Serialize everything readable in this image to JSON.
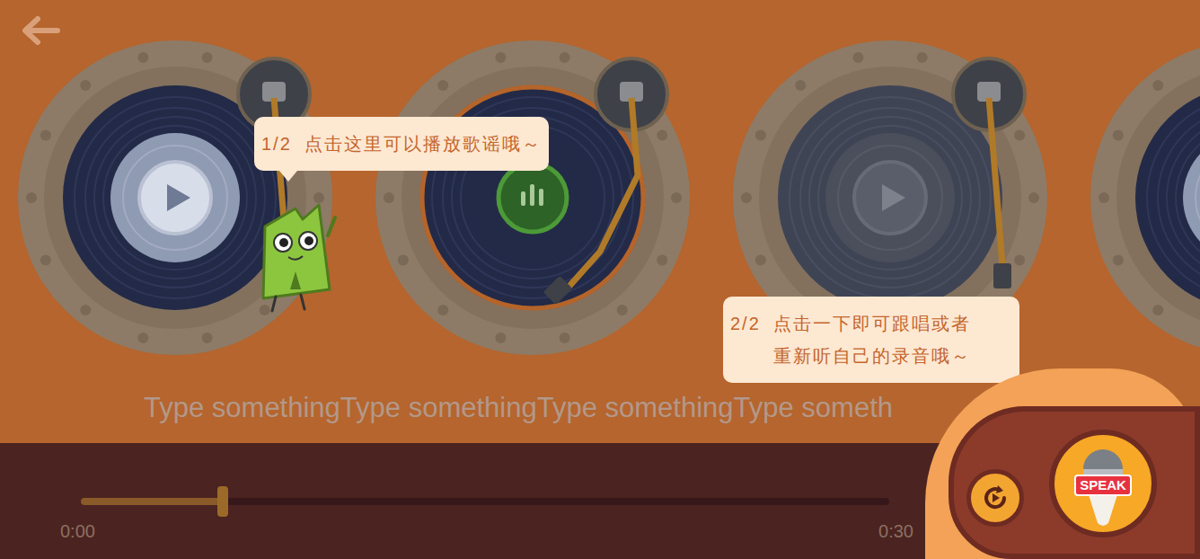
{
  "records": [
    {
      "playing": false,
      "disabled": false
    },
    {
      "playing": true,
      "disabled": false
    },
    {
      "playing": false,
      "disabled": true
    },
    {
      "playing": false,
      "disabled": false
    }
  ],
  "tooltips": [
    {
      "step": "1/2",
      "lines": [
        "点击这里可以播放歌谣哦～"
      ]
    },
    {
      "step": "2/2",
      "lines": [
        "点击一下即可跟唱或者",
        "重新听自己的录音哦～"
      ]
    }
  ],
  "lyric": "Type somethingType somethingType somethingType someth",
  "progress": {
    "level": 0.175,
    "start": "0:00",
    "end": "0:30"
  },
  "speak_button": {
    "label": "SPEAK"
  }
}
